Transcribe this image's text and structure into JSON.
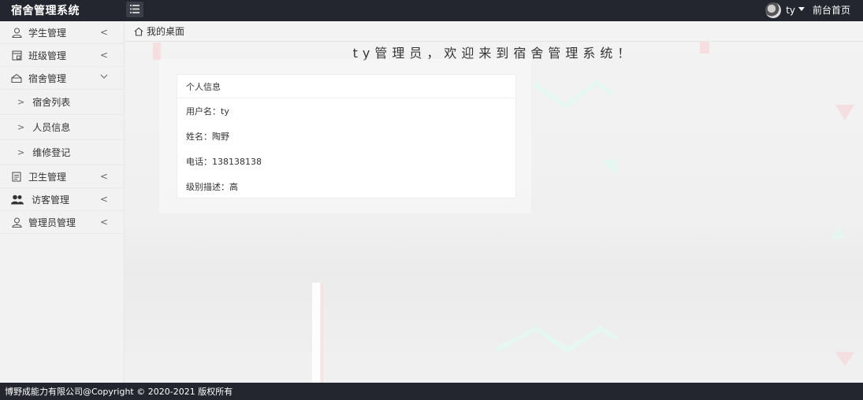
{
  "app": {
    "title": "宿舍管理系统"
  },
  "header": {
    "username": "ty",
    "home_link": "前台首页"
  },
  "sidebar": {
    "items": [
      {
        "label": "学生管理",
        "icon": "user-icon",
        "expanded": false
      },
      {
        "label": "班级管理",
        "icon": "class-icon",
        "expanded": false
      },
      {
        "label": "宿舍管理",
        "icon": "dorm-icon",
        "expanded": true
      },
      {
        "label": "卫生管理",
        "icon": "clipboard-icon",
        "expanded": false
      },
      {
        "label": "访客管理",
        "icon": "visitors-icon",
        "expanded": false
      },
      {
        "label": "管理员管理",
        "icon": "admin-icon",
        "expanded": false
      }
    ],
    "subitems": [
      {
        "label": "宿舍列表"
      },
      {
        "label": "人员信息"
      },
      {
        "label": "维修登记"
      }
    ]
  },
  "breadcrumb": {
    "label": "我的桌面"
  },
  "main": {
    "welcome": "ty管理员，欢迎来到宿舍管理系统！"
  },
  "card": {
    "title": "个人信息",
    "rows": [
      {
        "text": "用户名：ty"
      },
      {
        "text": "姓名：陶野"
      },
      {
        "text": "电话：138138138"
      },
      {
        "text": "级别描述：高"
      }
    ]
  },
  "footer": {
    "text": "博野成能力有限公司@Copyright © 2020-2021 版权所有"
  },
  "colors": {
    "header_bg": "#23262e",
    "sidebar_bg": "#f2f2f2",
    "accent_green": "#e6f7f1",
    "accent_pink": "#f7d6d9"
  }
}
